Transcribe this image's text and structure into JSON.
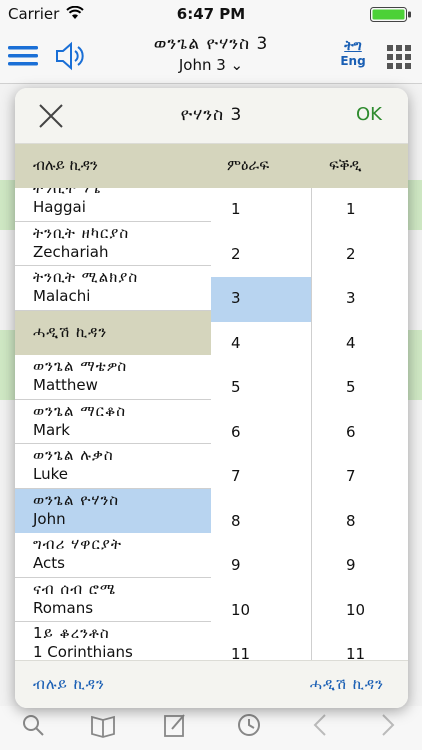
{
  "status_bar": {
    "carrier": "Carrier",
    "time": "6:47 PM"
  },
  "navbar": {
    "title_amharic": "ወንጌል ዮሃንስ 3",
    "title_english": "John 3 ⌄",
    "lang_top": "ትግ",
    "lang_bottom": "Eng",
    "icons": {
      "menu": "menu-icon",
      "speaker": "speaker-icon",
      "grid": "grid-icon"
    }
  },
  "colors": {
    "accent": "#1a5fb4",
    "ok": "#2e8b2e",
    "selected": "#b8d4f0",
    "section": "#d5d5bd"
  },
  "modal": {
    "title": "ዮሃንስ 3",
    "ok_label": "OK",
    "columns": {
      "book": "ብሉይ ኪዳን",
      "chapter": "ምዕራፍ",
      "verse": "ፍቕዲ"
    },
    "books": [
      {
        "amharic": "ትንቢተ ሃጌ",
        "english": "Haggai"
      },
      {
        "amharic": "ትንቢት ዘካርያስ",
        "english": "Zechariah"
      },
      {
        "amharic": "ትንቢት ሚልክያስ",
        "english": "Malachi"
      },
      {
        "section": "ሓዲሽ ኪዳን"
      },
      {
        "amharic": "ወንጌል ማቴዎስ",
        "english": "Matthew"
      },
      {
        "amharic": "ወንጌል ማርቆስ",
        "english": "Mark"
      },
      {
        "amharic": "ወንጌል ሉቃስ",
        "english": "Luke"
      },
      {
        "amharic": "ወንጌል ዮሃንስ",
        "english": "John",
        "selected": true
      },
      {
        "amharic": "ግብሪ ሃዋርያት",
        "english": "Acts"
      },
      {
        "amharic": "ናብ ሰብ ሮሜ",
        "english": "Romans"
      },
      {
        "amharic": "1ይ ቆረንቶስ",
        "english": "1 Corinthians"
      }
    ],
    "chapters": [
      "1",
      "2",
      "3",
      "4",
      "5",
      "6",
      "7",
      "8",
      "9",
      "10",
      "11"
    ],
    "selected_chapter": "3",
    "verses": [
      "1",
      "2",
      "3",
      "4",
      "5",
      "6",
      "7",
      "8",
      "9",
      "10",
      "11"
    ],
    "footer_left": "ብሉይ ኪዳን",
    "footer_right": "ሓዲሽ ኪዳን"
  },
  "toolbar_icons": [
    "search-icon",
    "book-icon",
    "note-icon",
    "history-icon",
    "back-icon",
    "forward-icon"
  ]
}
